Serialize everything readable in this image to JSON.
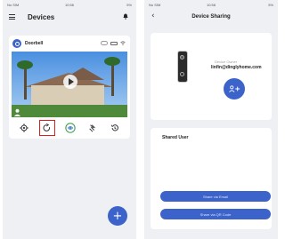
{
  "left_screen": {
    "status": {
      "carrier": "No SIM",
      "time": "10:56",
      "battery": "5%"
    },
    "header": {
      "title": "Devices",
      "menu_icon": "menu-icon",
      "bell_icon": "bell-icon"
    },
    "device": {
      "name": "Doorbell"
    },
    "toolbar": {
      "items": [
        {
          "icon": "gear-icon"
        },
        {
          "icon": "share-icon",
          "highlighted": true
        },
        {
          "icon": "eye-icon"
        },
        {
          "icon": "plug-icon"
        },
        {
          "icon": "history-icon"
        }
      ]
    },
    "fab": {
      "label": "+"
    },
    "colors": {
      "accent": "#3b63c9",
      "highlight": "#e21b1b",
      "background": "#eef0f3"
    }
  },
  "right_screen": {
    "status": {
      "carrier": "No SIM",
      "time": "10:58",
      "battery": "5%"
    },
    "header": {
      "back": "‹",
      "title": "Device Sharing"
    },
    "device_label": "Device Owner",
    "owner_email": "linfin@dinglyhome.com",
    "add_button": {
      "label": "+",
      "icon": "add-user-icon"
    },
    "shared_user_title": "Shared User",
    "buttons": {
      "share": "Share via Email",
      "share_code": "Share via QR Code"
    }
  }
}
